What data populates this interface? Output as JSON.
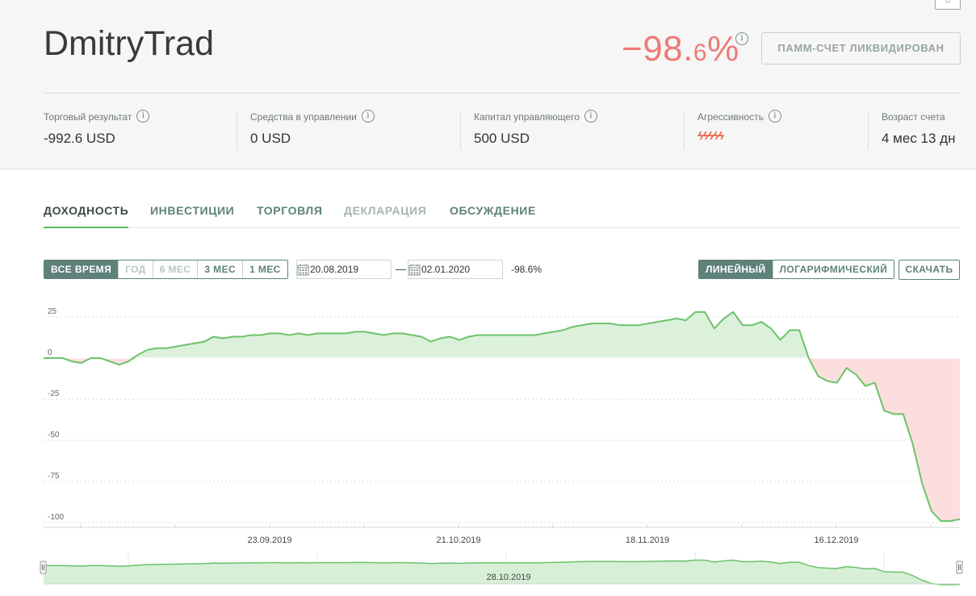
{
  "header": {
    "fav_icon": "star-icon",
    "title": "DmitryTrad",
    "return_main": "−98.",
    "return_small": "6",
    "return_suffix": "%",
    "info_glyph": "i",
    "status_button": "ПАММ-СЧЕТ ЛИКВИДИРОВАН",
    "stats": [
      {
        "label": "Торговый результат",
        "value": "-992.6 USD",
        "info": true
      },
      {
        "label": "Средства в управлении",
        "value": "0 USD",
        "info": true
      },
      {
        "label": "Капитал управляющего",
        "value": "500 USD",
        "info": true
      },
      {
        "label": "Агрессивность",
        "value": "ϟϟϟϟϟ",
        "info": true
      },
      {
        "label": "Возраст счета",
        "value": "4 мес 13 дн",
        "info": false
      }
    ]
  },
  "tabs": [
    {
      "label": "ДОХОДНОСТЬ",
      "state": "active"
    },
    {
      "label": "ИНВЕСТИЦИИ",
      "state": "normal"
    },
    {
      "label": "ТОРГОВЛЯ",
      "state": "normal"
    },
    {
      "label": "ДЕКЛАРАЦИЯ",
      "state": "disabled"
    },
    {
      "label": "ОБСУЖДЕНИЕ",
      "state": "normal"
    }
  ],
  "controls": {
    "periods": [
      {
        "label": "ВСЕ ВРЕМЯ",
        "state": "active"
      },
      {
        "label": "ГОД",
        "state": "muted"
      },
      {
        "label": "6 МЕС",
        "state": "muted"
      },
      {
        "label": "3 МЕС",
        "state": "normal"
      },
      {
        "label": "1 МЕС",
        "state": "normal"
      }
    ],
    "date_from": "20.08.2019",
    "date_sep": "—",
    "date_to": "02.01.2020",
    "range_return": "-98.6%",
    "scales": [
      {
        "label": "ЛИНЕЙНЫЙ",
        "state": "active"
      },
      {
        "label": "ЛОГАРИФМИЧЕСКИЙ",
        "state": "normal"
      }
    ],
    "download": "СКАЧАТЬ"
  },
  "colors": {
    "accent": "#5e817a",
    "line": "#6cc26a",
    "area_pos": "#dcf1dc",
    "area_neg": "#fcdede",
    "negative_text": "#ef7a77"
  },
  "chart_data": {
    "type": "line",
    "y_ticks": [
      25,
      0,
      -25,
      -50,
      -75,
      -100
    ],
    "ylim": [
      -105,
      30
    ],
    "x_tick_labels": [
      "23.09.2019",
      "21.10.2019",
      "18.11.2019",
      "16.12.2019"
    ],
    "navigator_label": "28.10.2019",
    "grid": true,
    "series": [
      {
        "values": [
          0,
          0,
          0,
          -2,
          -3,
          0,
          0,
          -2,
          -4,
          -2,
          2,
          5,
          6,
          6,
          7,
          8,
          9,
          10,
          13,
          12,
          13,
          13,
          14,
          14,
          15,
          15,
          14,
          15,
          14,
          15,
          15,
          15,
          15,
          16,
          16,
          15,
          14,
          15,
          15,
          14,
          13,
          10,
          12,
          13,
          11,
          13,
          14,
          14,
          14,
          14,
          14,
          14,
          14,
          15,
          16,
          17,
          19,
          20,
          21,
          21,
          21,
          20,
          20,
          20,
          21,
          22,
          23,
          24,
          23,
          28,
          28,
          18,
          24,
          28,
          20,
          20,
          22,
          18,
          11,
          17,
          17,
          0,
          -11,
          -14,
          -15,
          -6,
          -10,
          -17,
          -15,
          -32,
          -34,
          -34,
          -52,
          -76,
          -93,
          -99,
          -99,
          -98
        ]
      }
    ]
  }
}
